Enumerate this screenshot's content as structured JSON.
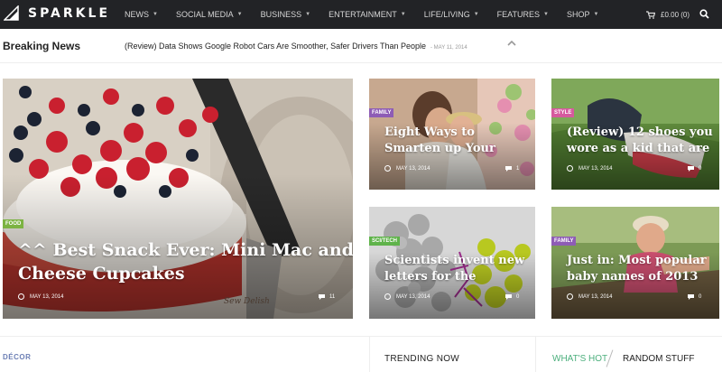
{
  "header": {
    "brand": "SPARKLE",
    "nav": [
      {
        "label": "NEWS"
      },
      {
        "label": "SOCIAL MEDIA"
      },
      {
        "label": "BUSINESS"
      },
      {
        "label": "ENTERTAINMENT"
      },
      {
        "label": "LIFE/LIVING"
      },
      {
        "label": "FEATURES"
      },
      {
        "label": "SHOP"
      }
    ],
    "cart": "£0.00 (0)"
  },
  "breaking": {
    "title": "Breaking News",
    "headline": "(Review) Data Shows Google Robot Cars Are Smoother, Safer Drivers Than People",
    "date": "- MAY 11, 2014"
  },
  "tiles": [
    {
      "category": "FOOD",
      "category_color": "#7cb342",
      "title_line1": "^^ Best Snack Ever: Mini Mac and",
      "title_line2": "Cheese Cupcakes",
      "date": "MAY 13, 2014",
      "comments": "11",
      "signature": "Sew Delish"
    },
    {
      "category": "FAMILY",
      "category_color": "#8e5cb5",
      "title_line1": "Eight Ways to",
      "title_line2": "Smarten up Your",
      "date": "MAY 13, 2014",
      "comments": "1"
    },
    {
      "category": "STYLE",
      "category_color": "#d65a9e",
      "title_line1": "(Review) 12 shoes you",
      "title_line2": "wore as a kid that are",
      "date": "MAY 13, 2014",
      "comments": "0"
    },
    {
      "category": "SCI/TECH",
      "category_color": "#5fb34a",
      "title_line1": "Scientists invent new",
      "title_line2": "letters for the",
      "date": "MAY 13, 2014",
      "comments": "0"
    },
    {
      "category": "FAMILY",
      "category_color": "#8e5cb5",
      "title_line1": "Just in: Most popular",
      "title_line2": "baby names of 2013",
      "date": "MAY 13, 2014",
      "comments": "0"
    }
  ],
  "bottom": {
    "decor": "DÉCOR",
    "trending": "TRENDING NOW",
    "whats_hot": "WHAT'S HOT",
    "random": "RANDOM STUFF"
  }
}
